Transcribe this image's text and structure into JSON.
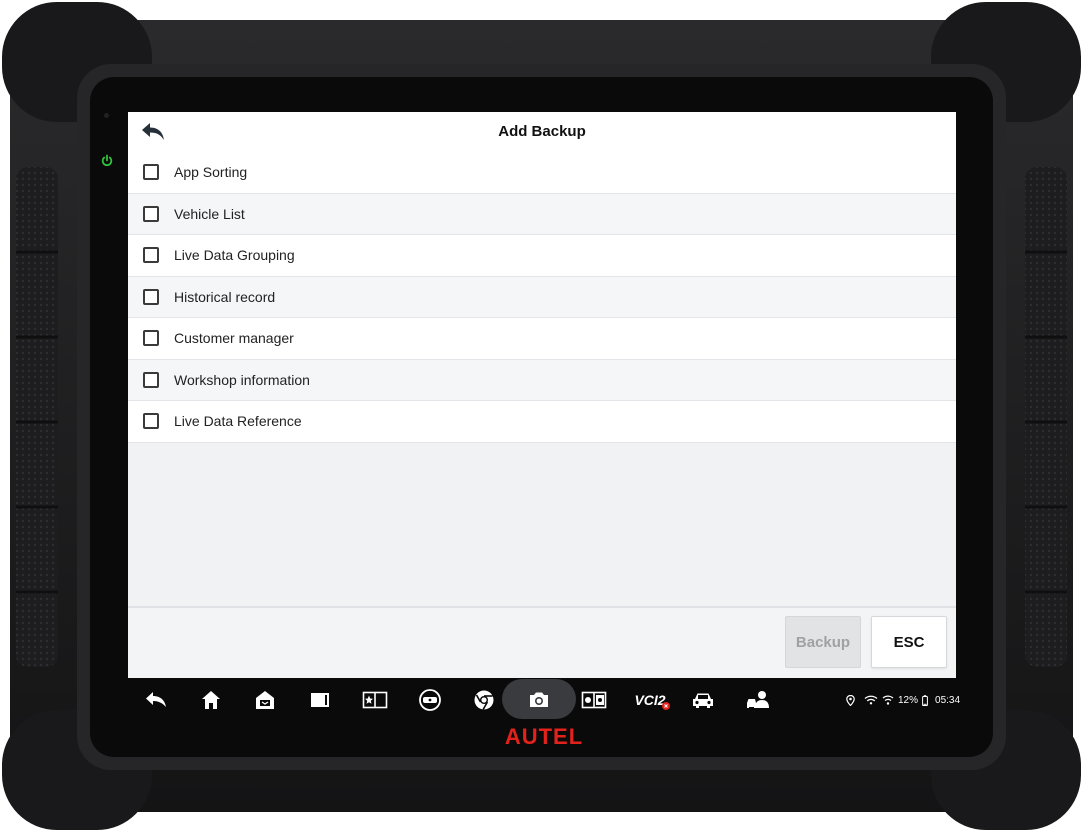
{
  "header": {
    "title": "Add Backup"
  },
  "backup_items": [
    {
      "label": "App Sorting",
      "checked": false
    },
    {
      "label": "Vehicle List",
      "checked": false
    },
    {
      "label": "Live Data Grouping",
      "checked": false
    },
    {
      "label": "Historical record",
      "checked": false
    },
    {
      "label": "Customer manager",
      "checked": false
    },
    {
      "label": "Workshop information",
      "checked": false
    },
    {
      "label": "Live Data Reference",
      "checked": false
    }
  ],
  "footer": {
    "backup_label": "Backup",
    "esc_label": "ESC",
    "backup_enabled": false
  },
  "navbar": {
    "icons": [
      "back-icon",
      "home-icon",
      "service-shop-icon",
      "window-icon",
      "favorites-icon",
      "vci-tool-icon",
      "chrome-icon",
      "camera-icon",
      "display-settings-icon",
      "vci-icon",
      "car-icon",
      "remote-support-icon"
    ],
    "vci_label": "VCI2"
  },
  "status_bar": {
    "battery": "12%",
    "time": "05:34",
    "icons": [
      "location-icon",
      "wifi-icon",
      "signal-icon",
      "battery-icon"
    ]
  },
  "brand": {
    "logo_text": "AUTEL",
    "color": "#e3221b"
  },
  "colors": {
    "accent_green": "#2ec23a",
    "screen_bg": "#f1f2f4",
    "device_body": "#1c1c1e"
  }
}
